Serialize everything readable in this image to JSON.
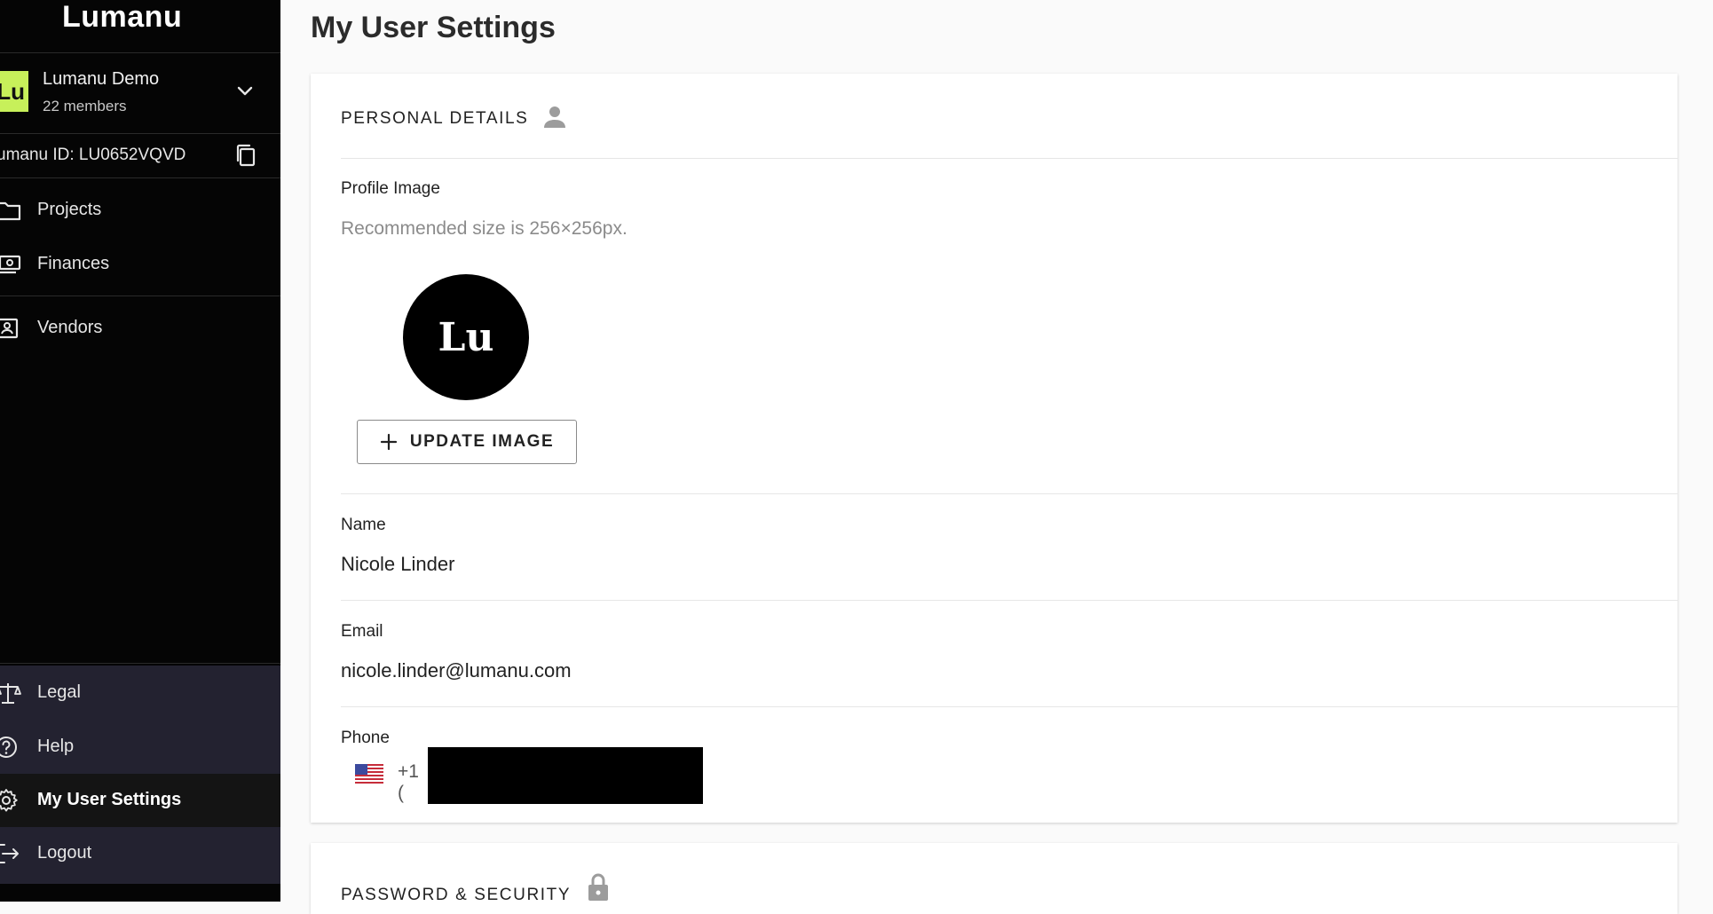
{
  "sidebar": {
    "logo": "Lumanu",
    "org": {
      "avatar_text": "Lu",
      "name": "Lumanu Demo",
      "members": "22 members",
      "accent": "#c7f05a"
    },
    "lumanu_id": "umanu ID: LU0652VQVD",
    "nav": [
      {
        "label": "Projects",
        "icon": "folder-icon"
      },
      {
        "label": "Finances",
        "icon": "money-icon"
      },
      {
        "label": "Vendors",
        "icon": "vendors-icon"
      }
    ],
    "bottom_nav": [
      {
        "label": "Legal",
        "icon": "scale-icon"
      },
      {
        "label": "Help",
        "icon": "help-icon"
      },
      {
        "label": "My User Settings",
        "icon": "gear-icon",
        "active": true
      },
      {
        "label": "Logout",
        "icon": "logout-icon"
      }
    ]
  },
  "main": {
    "title": "My User Settings",
    "personal": {
      "title": "PERSONAL DETAILS",
      "profile_label": "Profile Image",
      "profile_hint": "Recommended size is 256×256px.",
      "avatar_text": "Lu",
      "update_button": "UPDATE IMAGE",
      "name_label": "Name",
      "name_value": "Nicole Linder",
      "email_label": "Email",
      "email_value": "nicole.linder@lumanu.com",
      "phone_label": "Phone",
      "phone_dial": "+1 ("
    },
    "security": {
      "title": "PASSWORD & SECURITY"
    }
  }
}
